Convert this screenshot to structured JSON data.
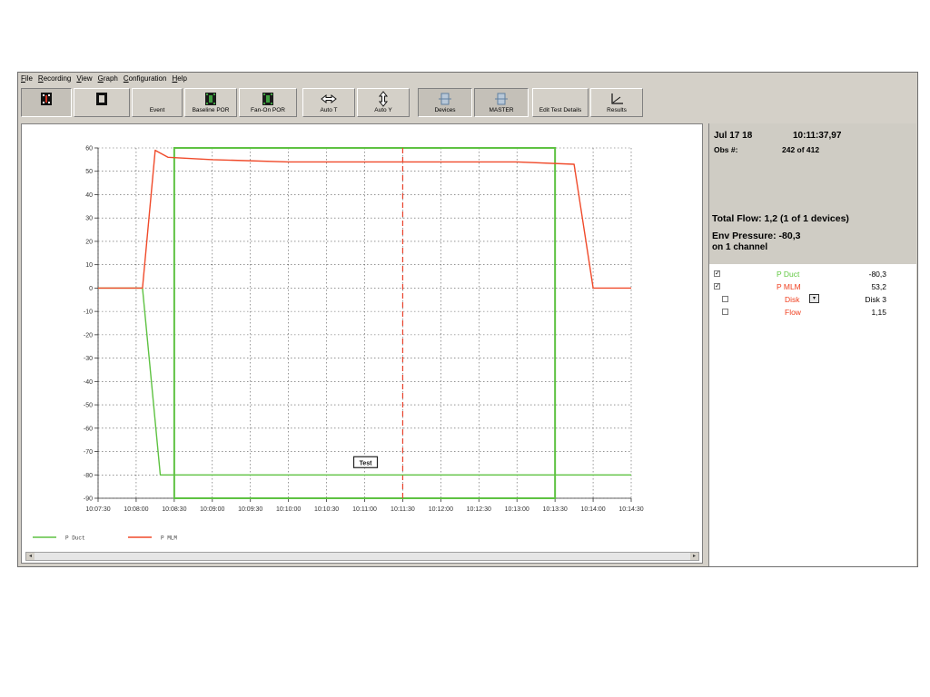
{
  "menu": [
    "File",
    "Recording",
    "View",
    "Graph",
    "Configuration",
    "Help"
  ],
  "toolbar": {
    "buttons": [
      {
        "label": "",
        "icon": "record-red-icon"
      },
      {
        "label": "",
        "icon": "stop-icon"
      },
      {
        "label": "Event",
        "icon": ""
      },
      {
        "label": "Baseline POR",
        "icon": "film-strip-icon"
      },
      {
        "label": "Fan-On POR",
        "icon": "film-strip-icon"
      },
      {
        "label": "Auto T",
        "icon": "horizontal-arrows-icon"
      },
      {
        "label": "Auto Y",
        "icon": "vertical-arrows-icon"
      },
      {
        "label": "Devices",
        "icon": "devices-icon"
      },
      {
        "label": "MASTER",
        "icon": "master-icon"
      },
      {
        "label": "Edit Test Details",
        "icon": ""
      },
      {
        "label": "Results",
        "icon": "results-chart-icon"
      }
    ]
  },
  "info": {
    "date": "Jul 17 18",
    "time": "10:11:37,97",
    "obs_label": "Obs #:",
    "obs_value": "242 of 412",
    "total_flow": "Total Flow: 1,2 (1 of 1 devices)",
    "env_pressure": "Env Pressure: -80,3",
    "env_channel": "on 1 channel"
  },
  "channels": [
    {
      "name": "P Duct",
      "value": "-80,3",
      "checked": true,
      "color": "#60c840",
      "indent": false
    },
    {
      "name": "P MLM",
      "value": "53,2",
      "checked": true,
      "color": "#f04020",
      "indent": false
    },
    {
      "name": "Disk",
      "value": "Disk 3",
      "checked": false,
      "color": "#f04020",
      "indent": true,
      "selector": true
    },
    {
      "name": "Flow",
      "value": "1,15",
      "checked": false,
      "color": "#f04020",
      "indent": true
    }
  ],
  "colors": {
    "p_duct": "#5ec242",
    "p_mlm": "#f04a2a",
    "grid": "#555555",
    "cursor": "#e8402a"
  },
  "chart_data": {
    "type": "line",
    "ylim": [
      -90,
      60
    ],
    "yticks": [
      "60",
      "50",
      "40",
      "30",
      "20",
      "10",
      "0",
      "-10",
      "-20",
      "-30",
      "-40",
      "-50",
      "-60",
      "-70",
      "-80",
      "-90"
    ],
    "xticks": [
      "10:07:30",
      "10:08:00",
      "10:08:30",
      "10:09:00",
      "10:09:30",
      "10:10:00",
      "10:10:30",
      "10:11:00",
      "10:11:30",
      "10:12:00",
      "10:12:30",
      "10:13:00",
      "10:13:30",
      "10:14:00",
      "10:14:30"
    ],
    "xlim": [
      "10:07:30",
      "10:14:30"
    ],
    "series": [
      {
        "name": "P Duct",
        "x": [
          "10:07:30",
          "10:08:05",
          "10:08:19",
          "10:09:00",
          "10:11:00",
          "10:12:00",
          "10:13:00",
          "10:13:45",
          "10:14:00",
          "10:14:30"
        ],
        "values": [
          0,
          0,
          -80,
          -80,
          -80,
          -80,
          -80,
          -80,
          -80,
          -80
        ],
        "color": "#5ec242"
      },
      {
        "name": "P MLM",
        "x": [
          "10:07:30",
          "10:08:05",
          "10:08:15",
          "10:08:25",
          "10:09:00",
          "10:10:00",
          "10:11:00",
          "10:12:00",
          "10:13:00",
          "10:13:45",
          "10:14:00",
          "10:14:30"
        ],
        "values": [
          0,
          0,
          59,
          56,
          55,
          54,
          54,
          54,
          54,
          53,
          0,
          0
        ],
        "color": "#f04a2a"
      }
    ],
    "region": {
      "start": "10:08:30",
      "end": "10:13:30",
      "ymin": -90,
      "ymax": 60,
      "color": "#5ec242"
    },
    "cursor": "10:11:30",
    "annotation": {
      "label": "Test",
      "x": "10:11:00",
      "y": -80
    },
    "legend": [
      {
        "name": "P Duct",
        "color": "#5ec242"
      },
      {
        "name": "P MLM",
        "color": "#f04a2a"
      }
    ],
    "legend_position": "bottom-left",
    "grid": true
  }
}
